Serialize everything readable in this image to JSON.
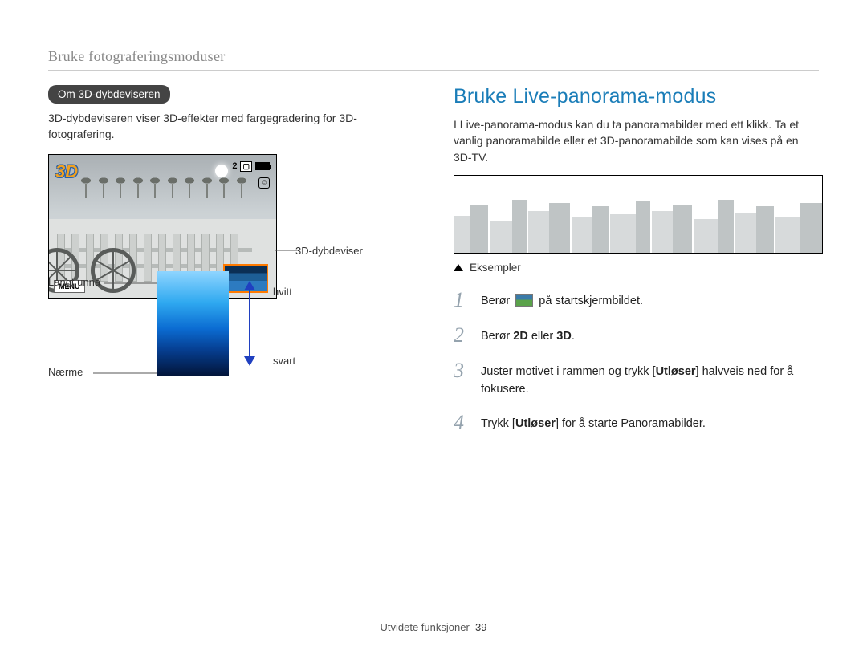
{
  "chapter": "Bruke fotograferingsmoduser",
  "left": {
    "pill": "Om 3D-dybdeviseren",
    "intro": "3D-dybdeviseren viser 3D-effekter med fargegradering for 3D-fotografering.",
    "screenshot": {
      "badge3d": "3D",
      "shots_remaining": "2",
      "menu_label": "MENU"
    },
    "callouts": {
      "depth_viewer": "3D-dybdeviser",
      "far": "Langt unna",
      "near": "Nærme",
      "white": "hvitt",
      "black": "svart"
    }
  },
  "right": {
    "title": "Bruke Live-panorama-modus",
    "intro": "I Live-panorama-modus kan du ta panoramabilder med ett klikk. Ta et vanlig panoramabilde eller et 3D-panoramabilde som kan vises på en 3D-TV.",
    "examples_label": "Eksempler",
    "steps": [
      {
        "n": "1",
        "pre": "Berør ",
        "icon": true,
        "post": " på startskjermbildet."
      },
      {
        "n": "2",
        "pre": "Berør ",
        "bold1": "2D",
        "mid": " eller ",
        "bold2": "3D",
        "post": "."
      },
      {
        "n": "3",
        "pre": "Juster motivet i rammen og trykk [",
        "bold1": "Utløser",
        "post": "] halvveis ned for å fokusere."
      },
      {
        "n": "4",
        "pre": "Trykk [",
        "bold1": "Utløser",
        "post": "] for å starte Panoramabilder."
      }
    ]
  },
  "footer": {
    "section": "Utvidete funksjoner",
    "page": "39"
  }
}
